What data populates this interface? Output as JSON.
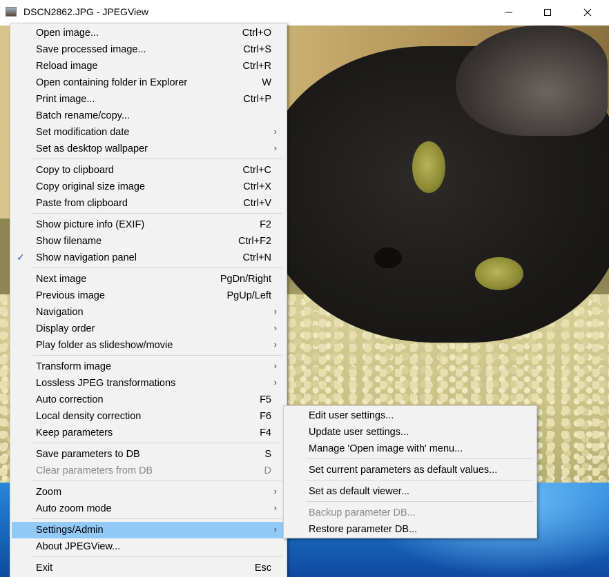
{
  "window": {
    "title": "DSCN2862.JPG - JPEGView",
    "minimize_glyph": "—",
    "maximize_glyph": "☐",
    "close_glyph": "✕"
  },
  "main_menu": {
    "items": [
      {
        "label": "Open image...",
        "shortcut": "Ctrl+O"
      },
      {
        "label": "Save processed image...",
        "shortcut": "Ctrl+S"
      },
      {
        "label": "Reload image",
        "shortcut": "Ctrl+R"
      },
      {
        "label": "Open containing folder in Explorer",
        "shortcut": "W"
      },
      {
        "label": "Print image...",
        "shortcut": "Ctrl+P"
      },
      {
        "label": "Batch rename/copy...",
        "shortcut": ""
      },
      {
        "label": "Set modification date",
        "submenu": true
      },
      {
        "label": "Set as desktop wallpaper",
        "submenu": true
      },
      {
        "label": "Copy to clipboard",
        "shortcut": "Ctrl+C"
      },
      {
        "label": "Copy original size image",
        "shortcut": "Ctrl+X"
      },
      {
        "label": "Paste from clipboard",
        "shortcut": "Ctrl+V"
      },
      {
        "label": "Show picture info (EXIF)",
        "shortcut": "F2"
      },
      {
        "label": "Show filename",
        "shortcut": "Ctrl+F2"
      },
      {
        "label": "Show navigation panel",
        "shortcut": "Ctrl+N",
        "checked": true
      },
      {
        "label": "Next image",
        "shortcut": "PgDn/Right"
      },
      {
        "label": "Previous image",
        "shortcut": "PgUp/Left"
      },
      {
        "label": "Navigation",
        "submenu": true
      },
      {
        "label": "Display order",
        "submenu": true
      },
      {
        "label": "Play folder as slideshow/movie",
        "submenu": true
      },
      {
        "label": "Transform image",
        "submenu": true
      },
      {
        "label": "Lossless JPEG transformations",
        "submenu": true
      },
      {
        "label": "Auto correction",
        "shortcut": "F5"
      },
      {
        "label": "Local density correction",
        "shortcut": "F6"
      },
      {
        "label": "Keep parameters",
        "shortcut": "F4"
      },
      {
        "label": "Save parameters to DB",
        "shortcut": "S"
      },
      {
        "label": "Clear parameters from DB",
        "shortcut": "D",
        "disabled": true
      },
      {
        "label": "Zoom",
        "submenu": true
      },
      {
        "label": "Auto zoom mode",
        "submenu": true
      },
      {
        "label": "Settings/Admin",
        "submenu": true,
        "highlighted": true
      },
      {
        "label": "About JPEGView...",
        "shortcut": ""
      },
      {
        "label": "Exit",
        "shortcut": "Esc"
      }
    ],
    "submenu_arrow": "›",
    "check_glyph": "✓"
  },
  "settings_submenu": {
    "items": [
      {
        "label": "Edit user settings..."
      },
      {
        "label": "Update user settings..."
      },
      {
        "label": "Manage 'Open image with' menu..."
      },
      {
        "label": "Set current parameters as default values..."
      },
      {
        "label": "Set as default viewer..."
      },
      {
        "label": "Backup parameter DB...",
        "disabled": true
      },
      {
        "label": "Restore parameter DB..."
      }
    ]
  },
  "colors": {
    "menu_bg": "#f2f2f2",
    "highlight": "#91c9f7",
    "disabled_text": "#8a8a8a"
  }
}
